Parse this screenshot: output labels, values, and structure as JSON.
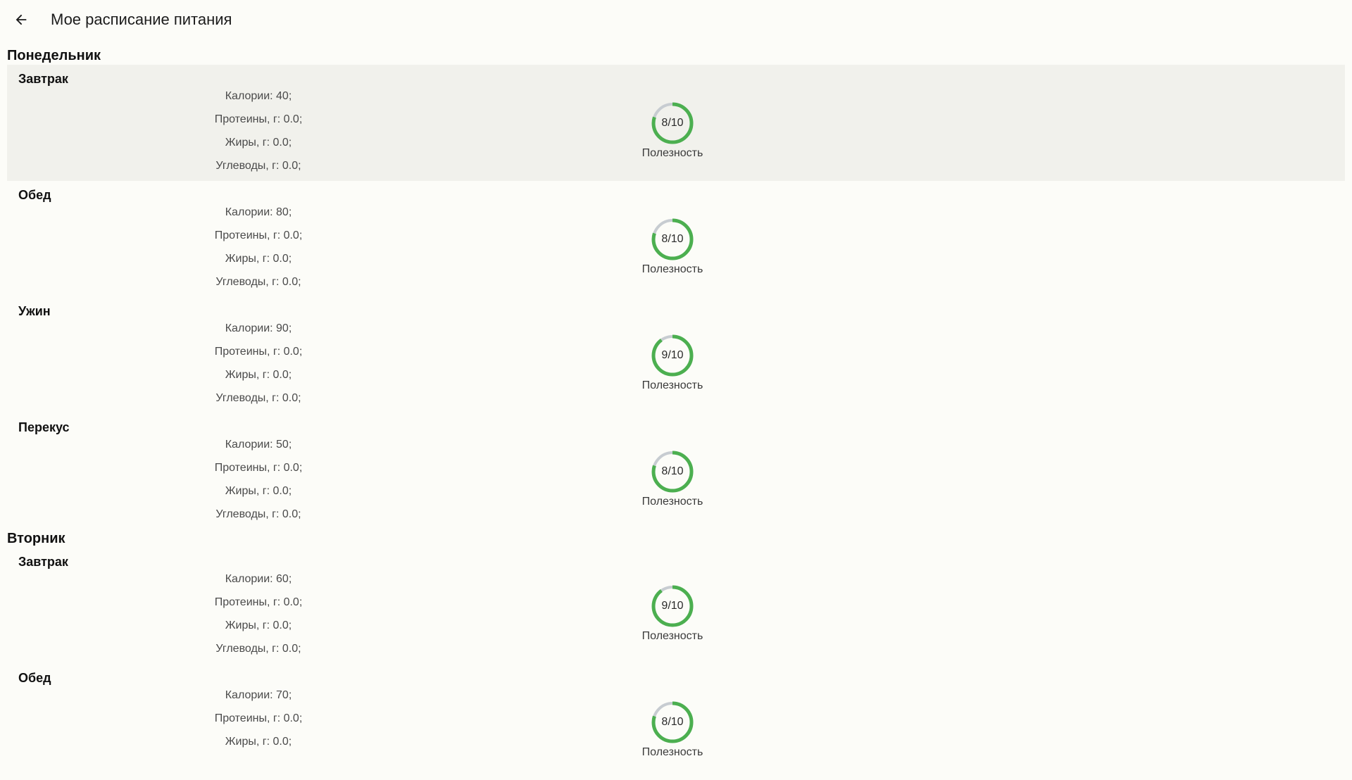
{
  "app_bar": {
    "back_icon": "arrow-back-icon",
    "title": "Мое расписание питания"
  },
  "colors": {
    "background": "#fcfcf8",
    "selected_card": "#f1f1ec",
    "ring_progress": "#4caf50",
    "ring_track": "#c7ccd1"
  },
  "days": [
    {
      "name": "Понедельник",
      "meals": [
        {
          "name": "Завтрак",
          "selected": true,
          "calories": "Калории: 40;",
          "protein": "Протеины, г: 0.0;",
          "fat": "Жиры, г: 0.0;",
          "carbs": "Углеводы, г: 0.0;",
          "score_text": "8/10",
          "score": 8,
          "score_max": 10,
          "score_label": "Полезность"
        },
        {
          "name": "Обед",
          "selected": false,
          "calories": "Калории: 80;",
          "protein": "Протеины, г: 0.0;",
          "fat": "Жиры, г: 0.0;",
          "carbs": "Углеводы, г: 0.0;",
          "score_text": "8/10",
          "score": 8,
          "score_max": 10,
          "score_label": "Полезность"
        },
        {
          "name": "Ужин",
          "selected": false,
          "calories": "Калории: 90;",
          "protein": "Протеины, г: 0.0;",
          "fat": "Жиры, г: 0.0;",
          "carbs": "Углеводы, г: 0.0;",
          "score_text": "9/10",
          "score": 9,
          "score_max": 10,
          "score_label": "Полезность"
        },
        {
          "name": "Перекус",
          "selected": false,
          "calories": "Калории: 50;",
          "protein": "Протеины, г: 0.0;",
          "fat": "Жиры, г: 0.0;",
          "carbs": "Углеводы, г: 0.0;",
          "score_text": "8/10",
          "score": 8,
          "score_max": 10,
          "score_label": "Полезность"
        }
      ]
    },
    {
      "name": "Вторник",
      "meals": [
        {
          "name": "Завтрак",
          "selected": false,
          "calories": "Калории: 60;",
          "protein": "Протеины, г: 0.0;",
          "fat": "Жиры, г: 0.0;",
          "carbs": "Углеводы, г: 0.0;",
          "score_text": "9/10",
          "score": 9,
          "score_max": 10,
          "score_label": "Полезность"
        },
        {
          "name": "Обед",
          "selected": false,
          "calories": "Калории: 70;",
          "protein": "Протеины, г: 0.0;",
          "fat": "Жиры, г: 0.0;",
          "carbs": "",
          "score_text": "8/10",
          "score": 8,
          "score_max": 10,
          "score_label": "Полезность"
        }
      ]
    }
  ]
}
